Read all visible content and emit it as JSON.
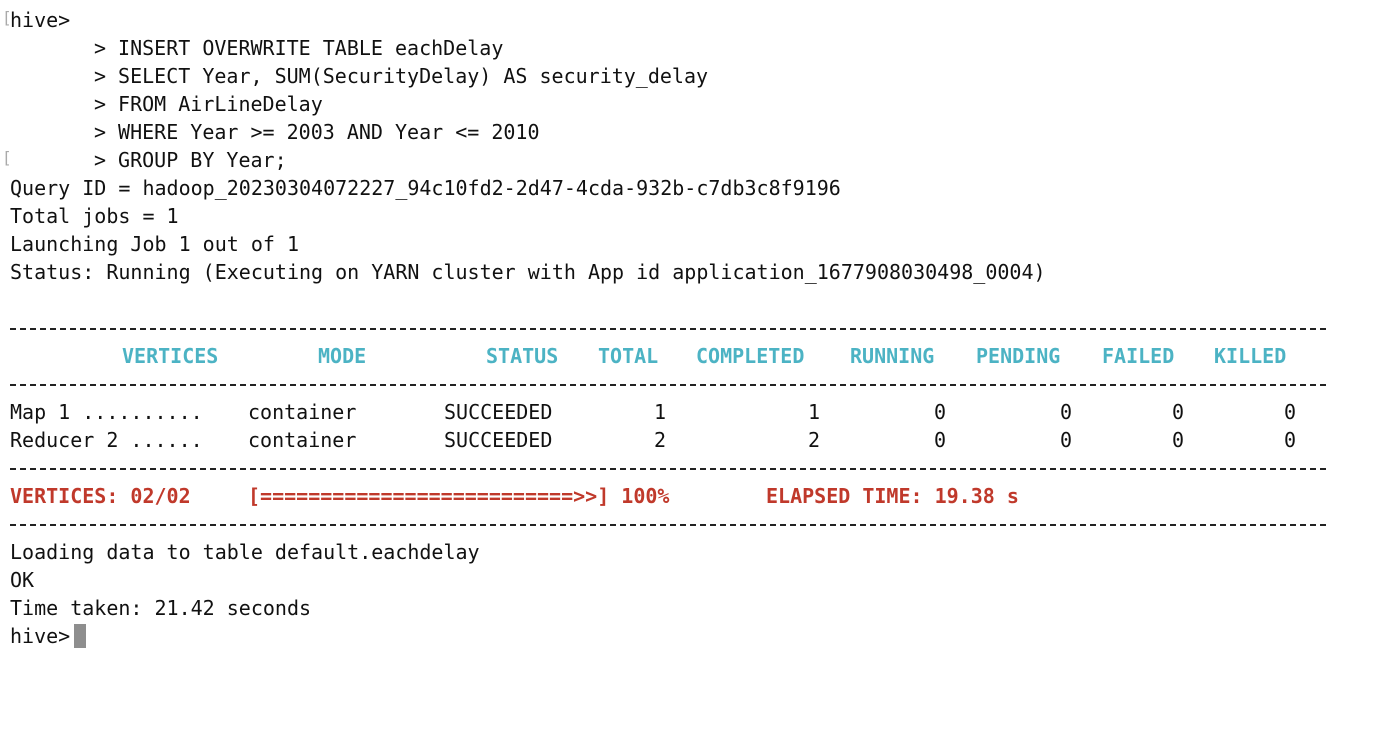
{
  "terminal": {
    "prompt": "hive>",
    "continuation_prompt": ">",
    "query_lines": [
      "INSERT OVERWRITE TABLE eachDelay",
      "SELECT Year, SUM(SecurityDelay) AS security_delay",
      "FROM AirLineDelay",
      "WHERE Year >= 2003 AND Year <= 2010",
      "GROUP BY Year;"
    ],
    "info_lines": [
      "Query ID = hadoop_20230304072227_94c10fd2-2d47-4cda-932b-c7db3c8f9196",
      "Total jobs = 1",
      "Launching Job 1 out of 1",
      "Status: Running (Executing on YARN cluster with App id application_1677908030498_0004)"
    ],
    "table": {
      "headers": [
        "VERTICES",
        "MODE",
        "STATUS",
        "TOTAL",
        "COMPLETED",
        "RUNNING",
        "PENDING",
        "FAILED",
        "KILLED"
      ],
      "rows": [
        [
          "Map 1 ..........",
          "container",
          "SUCCEEDED",
          "1",
          "1",
          "0",
          "0",
          "0",
          "0"
        ],
        [
          "Reducer 2 ......",
          "container",
          "SUCCEEDED",
          "2",
          "2",
          "0",
          "0",
          "0",
          "0"
        ]
      ],
      "colors": {
        "header": "#4cb3c4",
        "status": "#c0392b"
      }
    },
    "progress": {
      "vertices": "VERTICES: 02/02",
      "bar": "[==========================>>] 100%",
      "elapsed": "ELAPSED TIME: 19.38 s",
      "percent": 100
    },
    "result_lines": [
      "Loading data to table default.eachdelay",
      "OK",
      "Time taken: 21.42 seconds"
    ],
    "final_prompt": "hive>"
  }
}
